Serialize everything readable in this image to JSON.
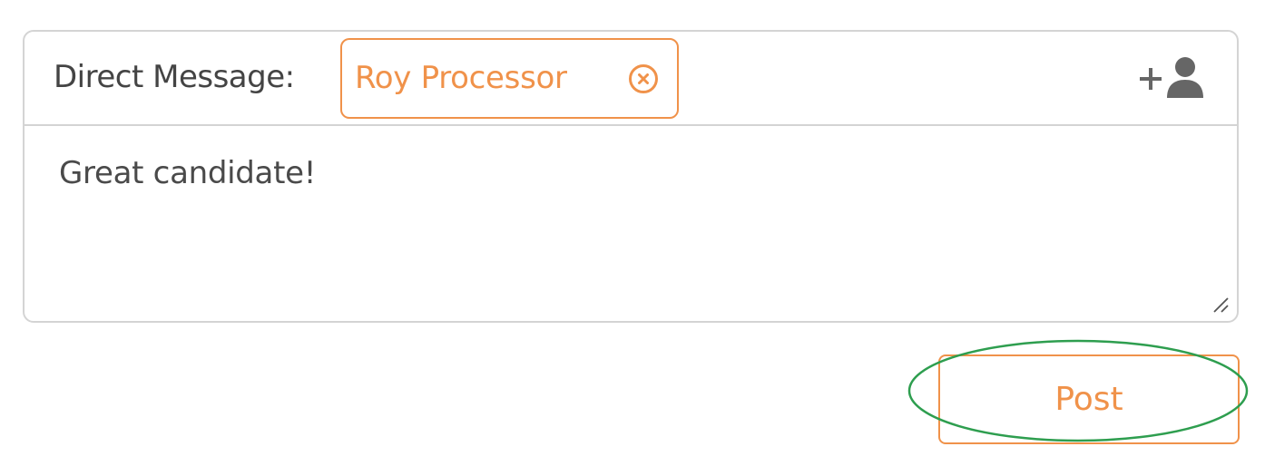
{
  "composer": {
    "recipient_label": "Direct Message:",
    "recipients": [
      {
        "name": "Roy Processor"
      }
    ],
    "message_text": "Great candidate!"
  },
  "actions": {
    "post_label": "Post"
  },
  "icons": {
    "chip_remove": "close-circle-icon",
    "add_recipient": "add-user-icon",
    "resize": "resize-handle-icon"
  },
  "colors": {
    "accent": "#f0924a",
    "border": "#d4d4d4",
    "text": "#444444",
    "icon_gray": "#666666",
    "highlight": "#2e9e4f"
  }
}
